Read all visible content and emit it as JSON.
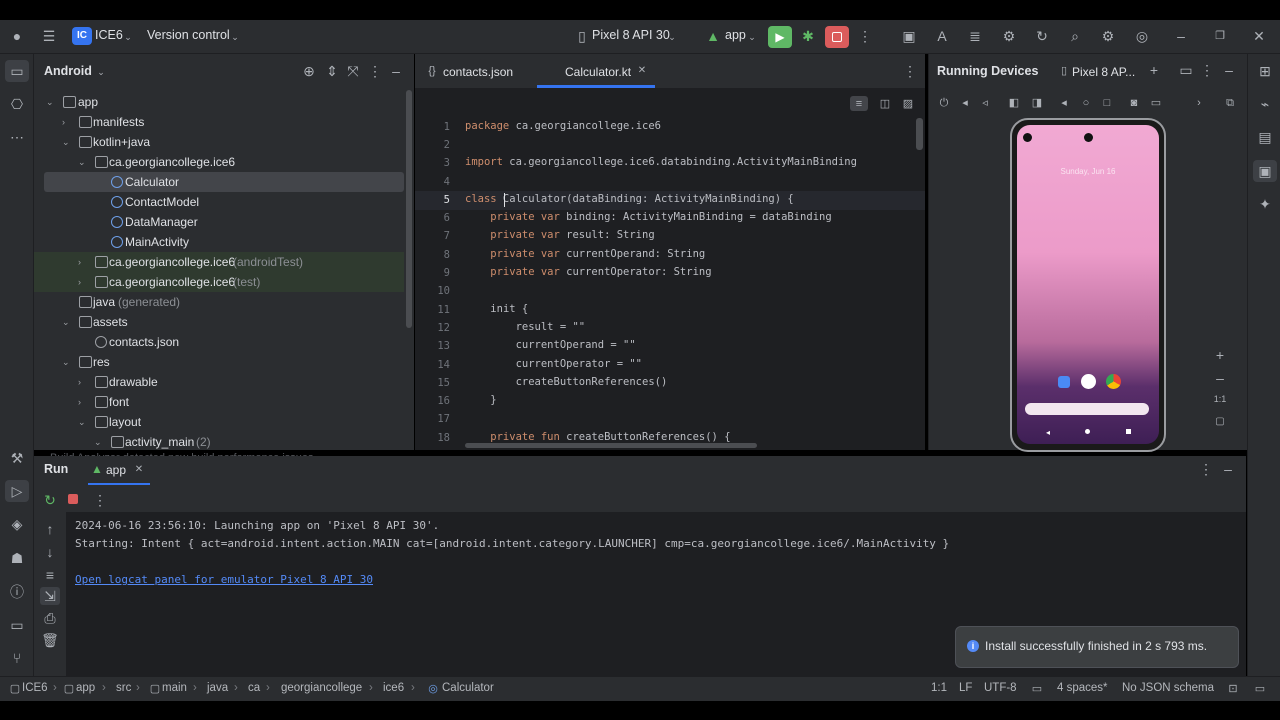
{
  "topbar": {
    "project_badge": "IC",
    "project": "ICE6",
    "vcs": "Version control",
    "device": "Pixel 8 API 30",
    "run_config": "app"
  },
  "project_panel": {
    "view": "Android",
    "tree": [
      {
        "label": "app",
        "note": ""
      },
      {
        "label": "manifests",
        "note": ""
      },
      {
        "label": "kotlin+java",
        "note": ""
      },
      {
        "label": "ca.georgiancollege.ice6",
        "note": ""
      },
      {
        "label": "Calculator",
        "note": ""
      },
      {
        "label": "ContactModel",
        "note": ""
      },
      {
        "label": "DataManager",
        "note": ""
      },
      {
        "label": "MainActivity",
        "note": ""
      },
      {
        "label": "ca.georgiancollege.ice6",
        "note": "(androidTest)"
      },
      {
        "label": "ca.georgiancollege.ice6",
        "note": "(test)"
      },
      {
        "label": "java",
        "note": "(generated)"
      },
      {
        "label": "assets",
        "note": ""
      },
      {
        "label": "contacts.json",
        "note": ""
      },
      {
        "label": "res",
        "note": ""
      },
      {
        "label": "drawable",
        "note": ""
      },
      {
        "label": "font",
        "note": ""
      },
      {
        "label": "layout",
        "note": ""
      },
      {
        "label": "activity_main",
        "note": "(2)"
      }
    ],
    "ghost_text": "Build Analyzer detected new build performance issues"
  },
  "editor": {
    "tabs": [
      "contacts.json",
      "Calculator.kt"
    ],
    "active_tab": "Calculator.kt",
    "line_numbers": [
      "1",
      "2",
      "3",
      "4",
      "5",
      "6",
      "7",
      "8",
      "9",
      "10",
      "11",
      "12",
      "13",
      "14",
      "15",
      "16",
      "17",
      "18"
    ],
    "lines": [
      {
        "kw": "package",
        "text": " ca.georgiancollege.ice6"
      },
      {
        "kw": "",
        "text": ""
      },
      {
        "kw": "import",
        "text": " ca.georgiancollege.ice6.databinding.ActivityMainBinding"
      },
      {
        "kw": "",
        "text": ""
      },
      {
        "kw": "class",
        "text": " Calculator(dataBinding: ActivityMainBinding) {"
      },
      {
        "kw": "    private var",
        "text": " binding: ActivityMainBinding = dataBinding"
      },
      {
        "kw": "    private var",
        "text": " result: String"
      },
      {
        "kw": "    private var",
        "text": " currentOperand: String"
      },
      {
        "kw": "    private var",
        "text": " currentOperator: String"
      },
      {
        "kw": "",
        "text": ""
      },
      {
        "kw": "    ",
        "text": "init {"
      },
      {
        "kw": "        ",
        "text": "result = \"\""
      },
      {
        "kw": "        ",
        "text": "currentOperand = \"\""
      },
      {
        "kw": "        ",
        "text": "currentOperator = \"\""
      },
      {
        "kw": "        ",
        "text": "createButtonReferences()"
      },
      {
        "kw": "    ",
        "text": "}"
      },
      {
        "kw": "",
        "text": ""
      },
      {
        "kw": "    private fun",
        "text": " createButtonReferences() {"
      }
    ]
  },
  "devices": {
    "title": "Running Devices",
    "tab": "Pixel 8 AP...",
    "phone_date": "Sunday, Jun 16",
    "zoom": "1:1"
  },
  "run": {
    "title": "Run",
    "tab": "app",
    "log": [
      "2024-06-16 23:56:10: Launching app on 'Pixel 8 API 30'.",
      "Starting: Intent { act=android.intent.action.MAIN cat=[android.intent.category.LAUNCHER] cmp=ca.georgiancollege.ice6/.MainActivity }"
    ],
    "link": "Open logcat panel for emulator Pixel 8 API 30"
  },
  "toast": {
    "text": "Install successfully finished in 2 s 793 ms."
  },
  "statusbar": {
    "breadcrumbs": [
      "ICE6",
      "app",
      "src",
      "main",
      "java",
      "ca",
      "georgiancollege",
      "ice6",
      "Calculator"
    ],
    "position": "1:1",
    "line_sep": "LF",
    "encoding": "UTF-8",
    "indent": "4 spaces*",
    "schema": "No JSON schema"
  },
  "colors": {
    "accent": "#3574f0",
    "run_green": "#5fb865",
    "stop_red": "#db5c5c",
    "link": "#548af7"
  }
}
